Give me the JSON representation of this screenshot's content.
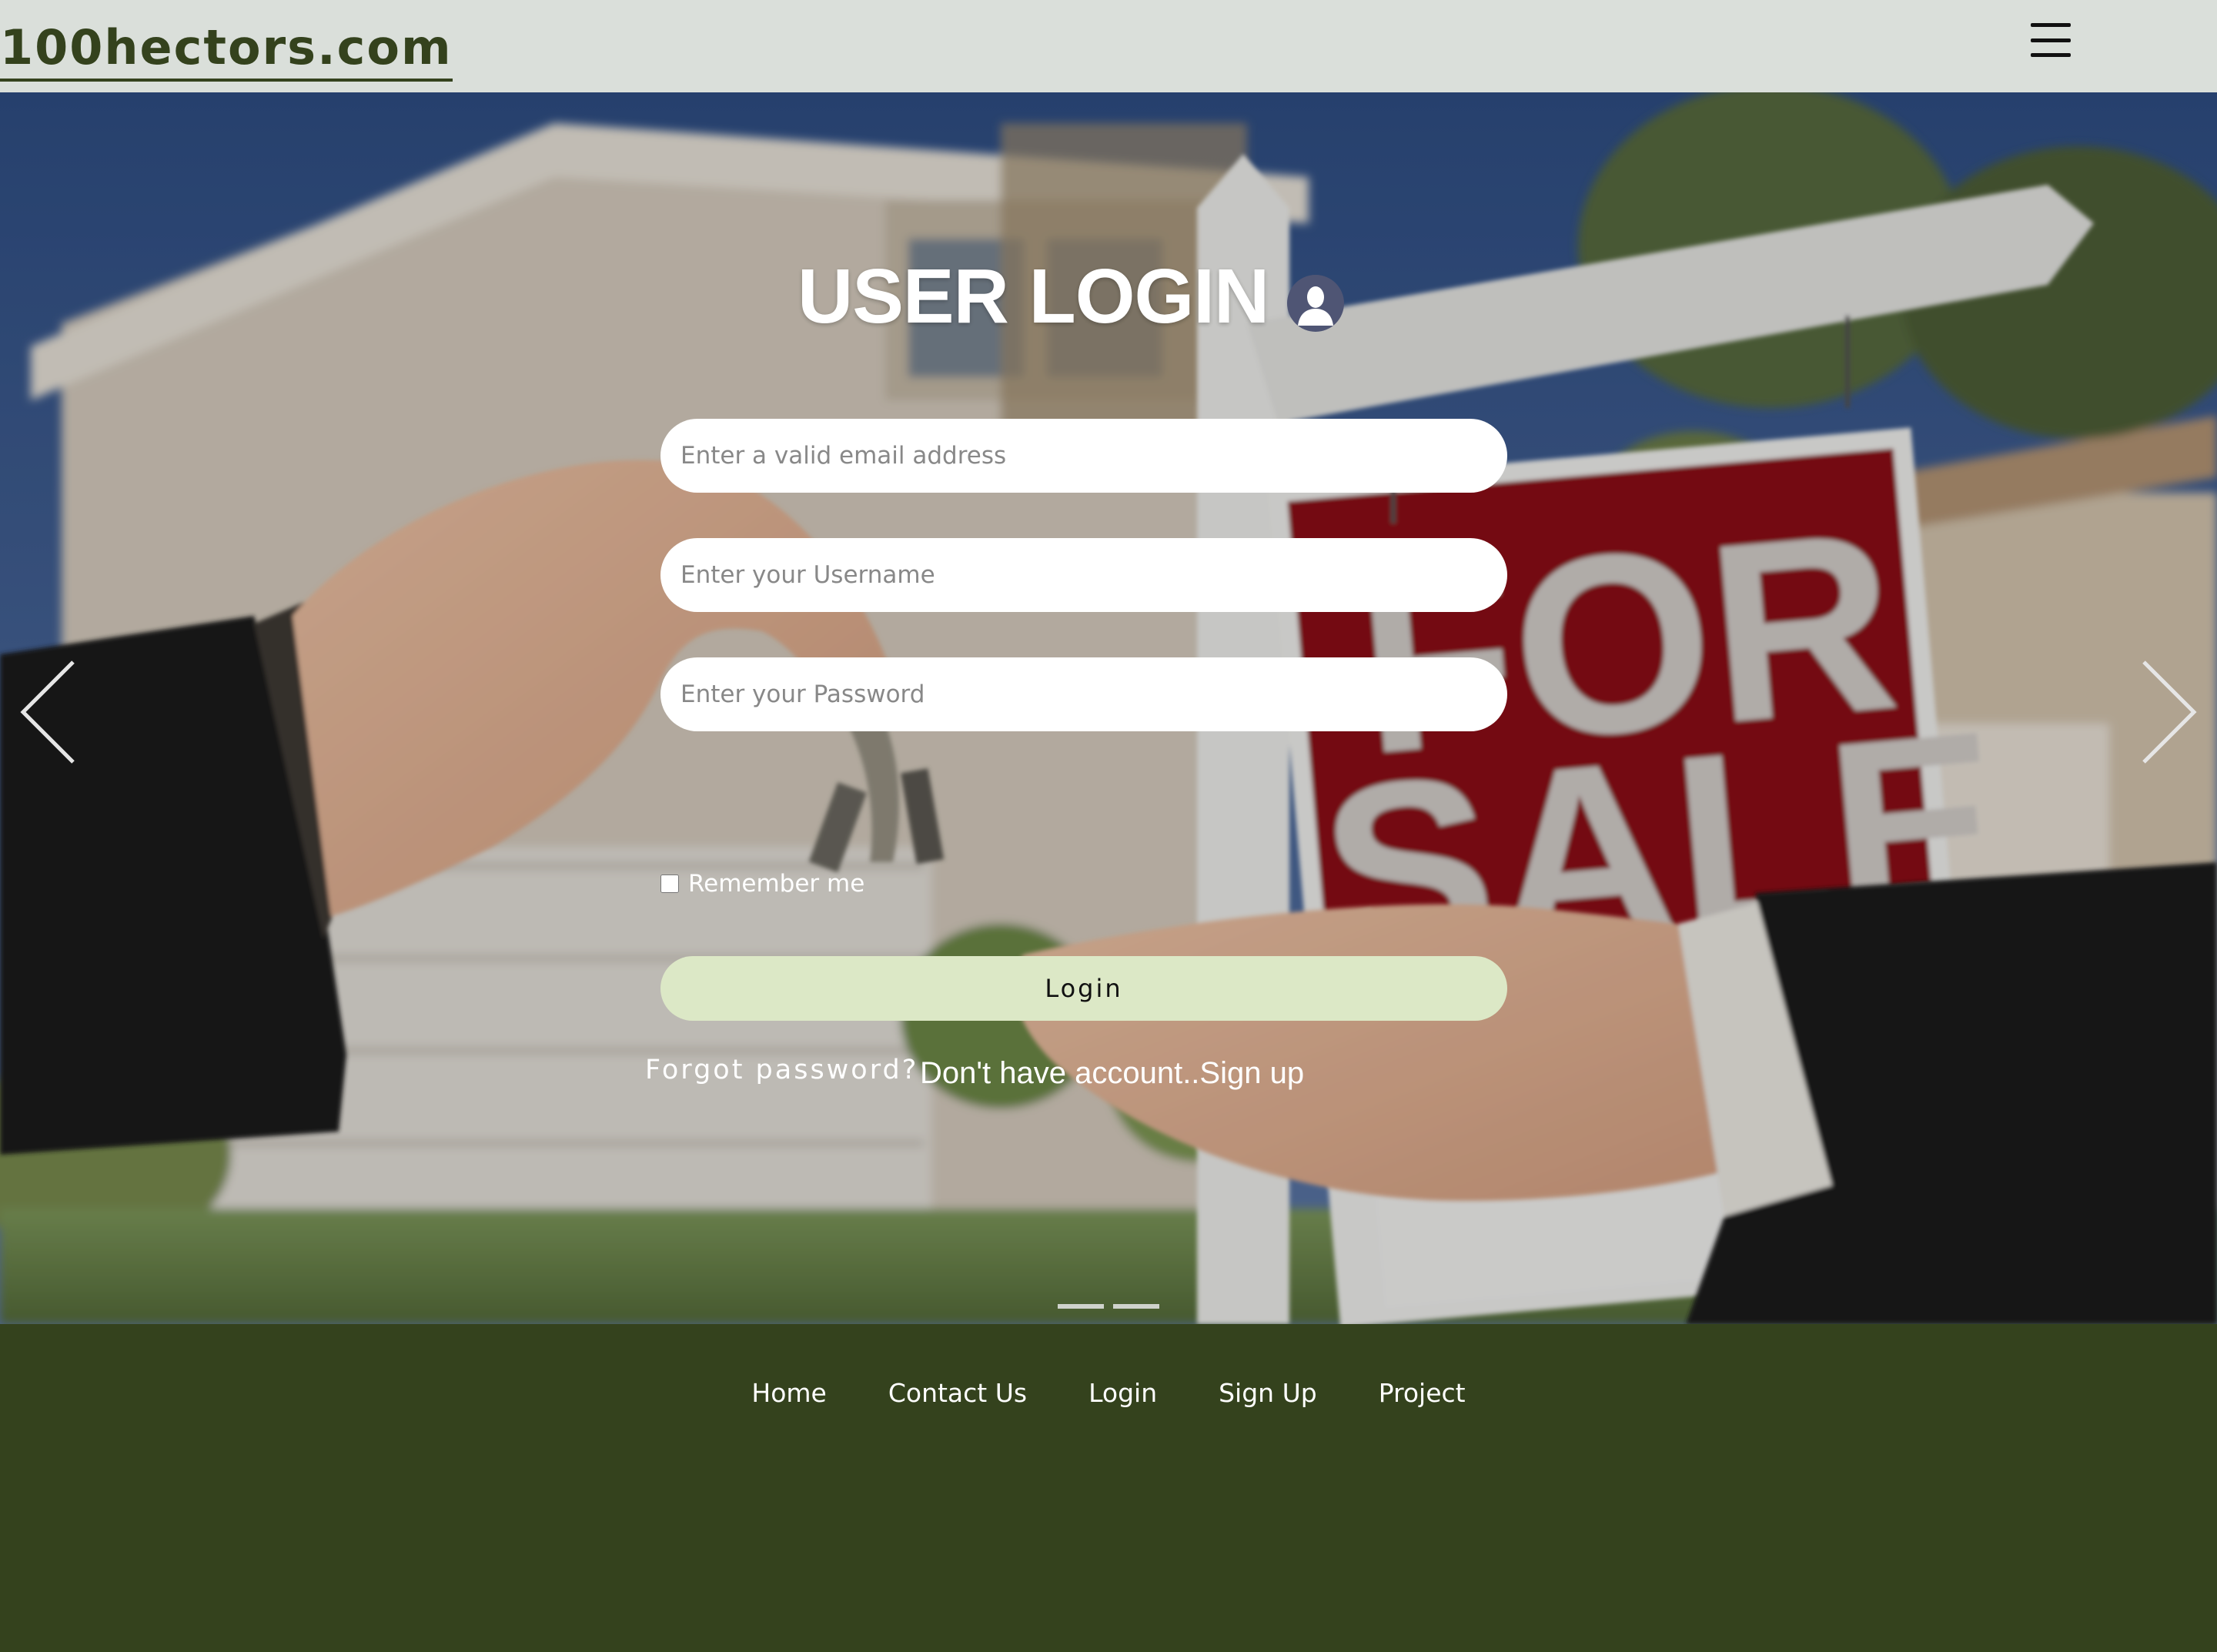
{
  "header": {
    "brand": "100hectors.com",
    "menu_icon": "hamburger-menu-icon"
  },
  "hero": {
    "background": "house-with-for-sale-sign-and-key-handover",
    "sign_text": [
      "FOR",
      "SALE"
    ],
    "prev_icon": "chevron-left-icon",
    "next_icon": "chevron-right-icon",
    "slides_count": 2
  },
  "login": {
    "title": "USER LOGIN",
    "title_icon": "user-avatar-icon",
    "email_placeholder": "Enter a valid email address",
    "email_value": "",
    "username_placeholder": "Enter your Username",
    "username_value": "",
    "password_placeholder": "Enter your Password",
    "password_value": "",
    "remember_label": "Remember me",
    "remember_checked": false,
    "submit_label": "Login",
    "forgot_label": "Forgot password?",
    "signup_label": "Don't have account..Sign up"
  },
  "footer": {
    "links": [
      "Home",
      "Contact Us",
      "Login",
      "Sign Up",
      "Project"
    ]
  },
  "colors": {
    "navbar_bg": "#dadfda",
    "brand": "#34421d",
    "footer_bg": "#34421d",
    "login_button": "#dce8c6",
    "sign_red": "#8e0d12"
  }
}
